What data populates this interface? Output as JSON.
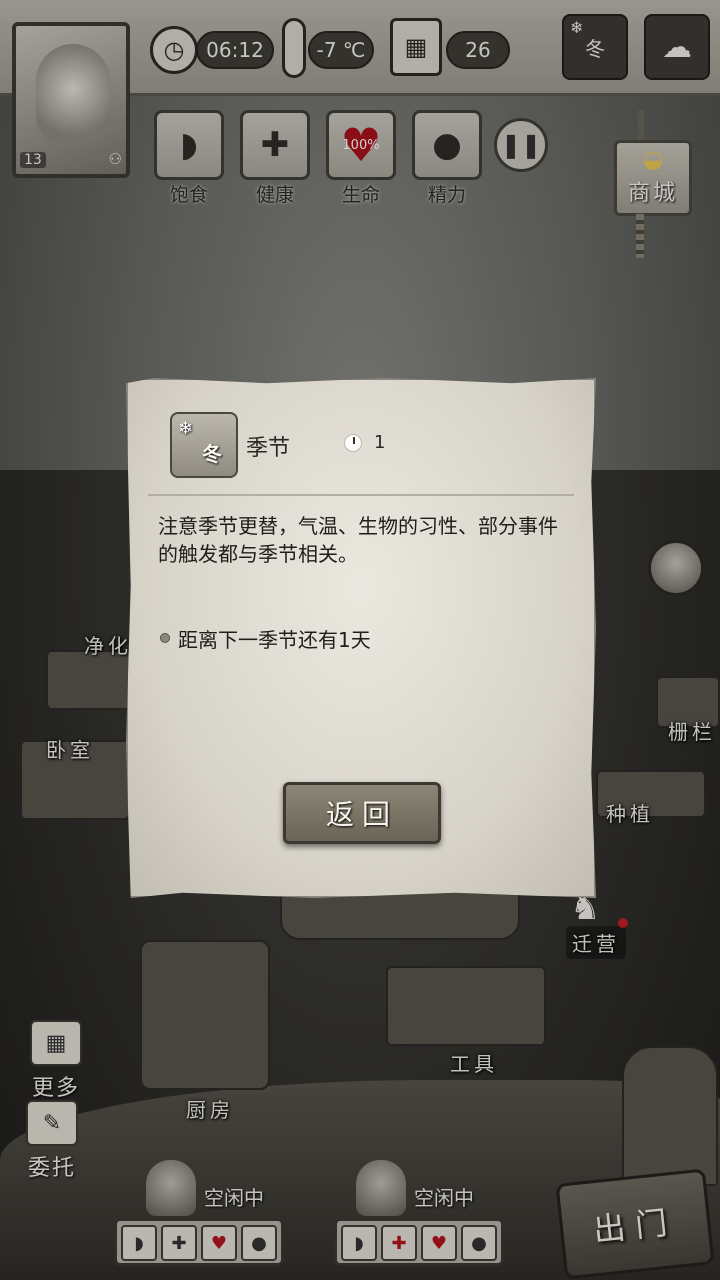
{
  "hud": {
    "time": "06:12",
    "temperature": "-7 ℃",
    "day": "26",
    "player_level": "13",
    "season_badge": "冬",
    "shop_label": "商城"
  },
  "stats": [
    {
      "label": "饱食",
      "icon": "stomach-icon"
    },
    {
      "label": "健康",
      "icon": "cross-icon"
    },
    {
      "label": "生命",
      "icon": "heart-icon",
      "value": "100%"
    },
    {
      "label": "精力",
      "icon": "person-icon"
    }
  ],
  "scene": {
    "labels": {
      "purify": "净化",
      "bedroom": "卧室",
      "fence": "栅栏",
      "planting": "种植",
      "relocate": "迁营",
      "tools": "工具",
      "kitchen": "厨房"
    },
    "more_label": "更多",
    "delegate_label": "委托",
    "exit_label": "出门"
  },
  "workers": [
    {
      "status": "空闲中"
    },
    {
      "status": "空闲中"
    }
  ],
  "dialog": {
    "icon_text": "冬",
    "title": "季节",
    "count": "1",
    "description": "注意季节更替，气温、生物的习性、部分事件的触发都与季节相关。",
    "bullet": "距离下一季节还有1天",
    "back_label": "返回"
  },
  "colors": {
    "parchment": "#e3dfd6",
    "heart_red": "#b2141d",
    "wood_button": "#7d7668"
  }
}
